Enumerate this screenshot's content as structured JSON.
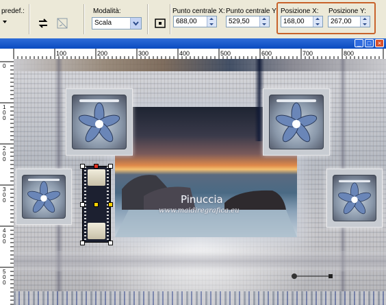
{
  "toolbar": {
    "preset_label": "predef.:",
    "mode_label": "Modalità:",
    "mode_value": "Scala",
    "center_x_label": "Punto centrale X:",
    "center_x_value": "688,00",
    "center_y_label": "Punto centrale Y:",
    "center_y_value": "529,50",
    "pos_x_label": "Posizione X:",
    "pos_x_value": "168,00",
    "pos_y_label": "Posizione Y:",
    "pos_y_value": "267,00"
  },
  "ruler": {
    "h_ticks": [
      "100",
      "200",
      "300",
      "400",
      "500",
      "600",
      "700",
      "800"
    ],
    "v_ticks": [
      "0",
      "1 0 0",
      "2 0 0",
      "3 0 0",
      "4 0 0",
      "5 0 0"
    ]
  },
  "canvas": {
    "watermark_title": "Pinuccia",
    "watermark_url": "www.maidiregrafica.eu"
  },
  "colors": {
    "highlight": "#c8622a",
    "titlebar": "#0a4bc0"
  }
}
